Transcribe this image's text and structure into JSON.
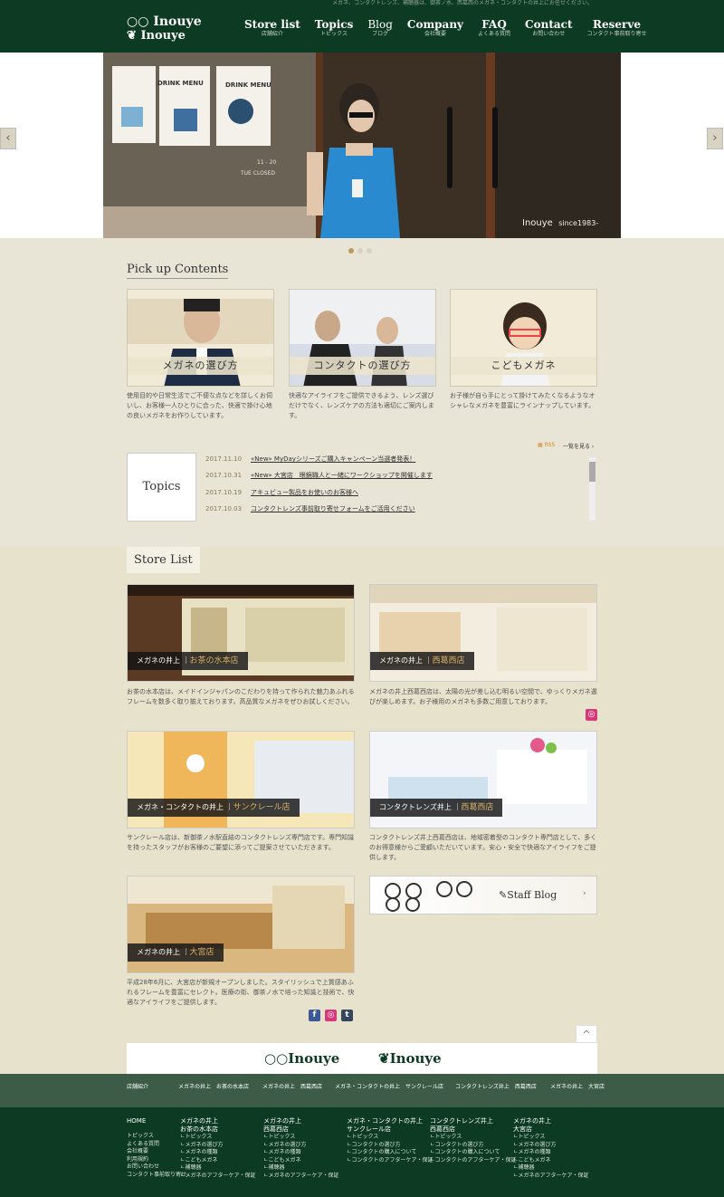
{
  "top_notice": "メガネ、コンタクトレンズ、補聴器は、御茶ノ水、西葛西のメガネ・コンタクトの井上にお任せください。",
  "logo": {
    "line1": "Inouye",
    "line2": "Inouye"
  },
  "nav": [
    {
      "en": "Store list",
      "jp": "店舗紹介"
    },
    {
      "en": "Topics",
      "jp": "トピックス"
    },
    {
      "en": "Blog",
      "jp": "ブログ"
    },
    {
      "en": "Company",
      "jp": "会社概要"
    },
    {
      "en": "FAQ",
      "jp": "よくある質問"
    },
    {
      "en": "Contact",
      "jp": "お問い合わせ"
    },
    {
      "en": "Reserve",
      "jp": "コンタクト事前取り寄せ"
    }
  ],
  "hero": {
    "caption": "Inouye",
    "since": "since1983-",
    "menu": "DRINK MENU",
    "door": "TUE CLOSED",
    "hours": "11 - 20",
    "prev": "‹",
    "next": "›"
  },
  "pickup": {
    "title": "Pick up Contents",
    "cards": [
      {
        "label": "メガネの選び方",
        "text": "使用目的や日常生活でご不便な点などを詳しくお伺いし、お客様一人ひとりに合った、快適で掛け心地の良いメガネをお作りしています。"
      },
      {
        "label": "コンタクトの選び方",
        "text": "快適なアイライフをご提供できるよう、レンズ選びだけでなく、レンズケアの方法も適切にご案内します。"
      },
      {
        "label": "こどもメガネ",
        "text": "お子様が自ら手にとって掛けてみたくなるようなオシャレなメガネを豊富にラインナップしています。"
      }
    ]
  },
  "topics": {
    "label": "Topics",
    "rss": "RSS",
    "more": "一覧を見る ›",
    "items": [
      {
        "date": "2017.11.10",
        "title": "«New» MyDayシリーズご購入キャンペーン当選者発表！"
      },
      {
        "date": "2017.10.31",
        "title": "«New» 大宮店　眼鏡職人と一緒にワークショップを開催します"
      },
      {
        "date": "2017.10.19",
        "title": "アキュビュー製品をお使いのお客様へ"
      },
      {
        "date": "2017.10.03",
        "title": "コンタクトレンズ事前取り寄せフォームをご活用ください"
      }
    ]
  },
  "stores": {
    "title": "Store List",
    "items": [
      {
        "prefix": "メガネの井上",
        "name": "お茶の水本店",
        "text": "お茶の水本店は、メイドインジャパンのこだわりを持って作られた魅力あふれるフレームを数多く取り揃えております。高品質なメガネをぜひお試しください。"
      },
      {
        "prefix": "メガネの井上",
        "name": "西葛西店",
        "text": "メガネの井上西葛西店は、太陽の光が差し込む明るい空間で、ゆっくりメガネ選びが楽しめます。お子様用のメガネも多数ご用意しております。"
      },
      {
        "prefix": "メガネ・コンタクトの井上",
        "name": "サンクレール店",
        "text": "サンクレール店は、新御茶ノ水駅直結のコンタクトレンズ専門店です。専門知識を持ったスタッフがお客様のご要望に添ってご提案させていただきます。"
      },
      {
        "prefix": "コンタクトレンズ井上",
        "name": "西葛西店",
        "text": "コンタクトレンズ井上西葛西店は、地域密着型のコンタクト専門店として、多くのお得意様からご愛顧いただいています。安心・安全で快適なアイライフをご提供します。"
      },
      {
        "prefix": "メガネの井上",
        "name": "大宮店",
        "text": "平成28年6月に、大宮店が新規オープンしました。スタイリッシュで上質感あふれるフレームを豊富にセレクト。医療の街、御茶ノ水で培った知識と技術で、快適なアイライフをご提供します。"
      }
    ],
    "staff_blog": "Staff Blog"
  },
  "social": {
    "facebook": "f",
    "instagram": "◎",
    "tumblr": "t"
  },
  "pagetop": "^",
  "footer_logos": [
    "Inouye",
    "Inouye"
  ],
  "footnav": {
    "label": "店舗紹介",
    "links": [
      "メガネの井上　お茶の水本店",
      "メガネの井上　西葛西店",
      "メガネ・コンタクトの井上　サンクレール店",
      "コンタクトレンズ井上　西葛西店",
      "メガネの井上　大宮店"
    ]
  },
  "footer": {
    "home": {
      "title": "HOME",
      "links": [
        "トピックス",
        "よくある質問",
        "会社概要",
        "利用規約",
        "お問い合わせ",
        "コンタクト事前取り寄せ"
      ]
    },
    "cols": [
      {
        "title1": "メガネの井上",
        "title2": "お茶の水本店",
        "links": [
          "トピックス",
          "メガネの選び方",
          "メガネの種類",
          "こどもメガネ",
          "補聴器",
          "メガネのアフターケア・保証"
        ]
      },
      {
        "title1": "メガネの井上",
        "title2": "西葛西店",
        "links": [
          "トピックス",
          "メガネの選び方",
          "メガネの種類",
          "こどもメガネ",
          "補聴器",
          "メガネのアフターケア・保証"
        ]
      },
      {
        "title1": "メガネ・コンタクトの井上",
        "title2": "サンクレール店",
        "links": [
          "トピックス",
          "コンタクトの選び方",
          "コンタクトの購入について",
          "コンタクトのアフターケア・保証"
        ]
      },
      {
        "title1": "コンタクトレンズ井上",
        "title2": "西葛西店",
        "links": [
          "トピックス",
          "コンタクトの選び方",
          "コンタクトの購入について",
          "コンタクトのアフターケア・保証"
        ]
      },
      {
        "title1": "メガネの井上",
        "title2": "大宮店",
        "links": [
          "トピックス",
          "メガネの選び方",
          "メガネの種類",
          "こどもメガネ",
          "補聴器",
          "メガネのアフターケア・保証"
        ]
      }
    ]
  }
}
